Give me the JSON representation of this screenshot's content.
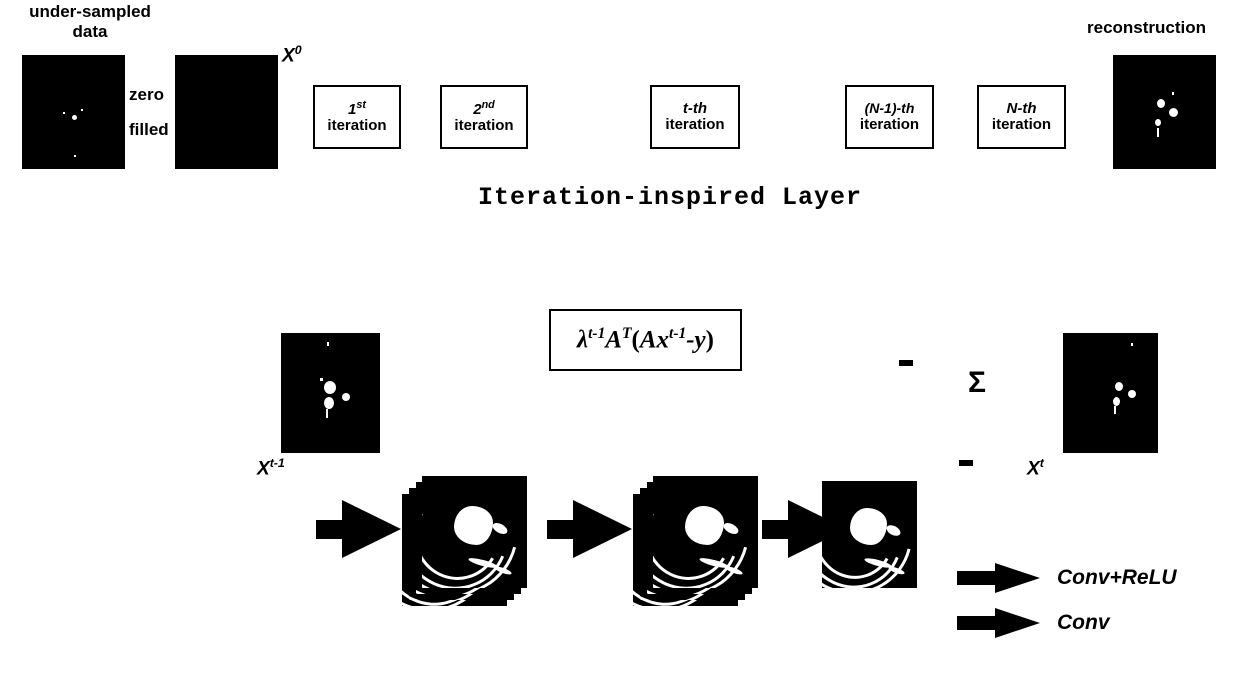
{
  "figure": {
    "title": "Iteration-inspired Layer",
    "top_row": {
      "undersampled_label": "under-sampled\ndata",
      "undersampled_label_line1": "under-sampled",
      "undersampled_label_line2": "data",
      "zero_label": "zero",
      "filled_label": "filled",
      "x0_label": "X",
      "x0_sup": "0",
      "reconstruction_label": "reconstruction",
      "iterations": [
        {
          "top": "1st",
          "top_main": "1",
          "top_sup": "st",
          "bottom": "iteration"
        },
        {
          "top": "2nd",
          "top_main": "2",
          "top_sup": "nd",
          "bottom": "iteration"
        },
        {
          "top": "t-th",
          "bottom": "iteration"
        },
        {
          "top": "(N-1)-th",
          "bottom": "iteration"
        },
        {
          "top": "N-th",
          "bottom": "iteration"
        }
      ]
    },
    "detail_row": {
      "formula_plain": "λ^{t-1} A^T ( A x^{t-1} - y )",
      "formula_lambda": "λ",
      "formula_lambda_sup": "t-1",
      "formula_A": "A",
      "formula_A_sup": "T",
      "formula_open": "(",
      "formula_Ax": "Ax",
      "formula_x_sup": "t-1",
      "formula_minus_y": "-y",
      "formula_close": ")",
      "xprev_label": "X",
      "xprev_sup": "t-1",
      "xnext_label": "X",
      "xnext_sup": "t",
      "sigma_symbol": "Σ",
      "sign_top": "-",
      "sign_bottom": "-"
    },
    "legend": [
      {
        "label": "Conv+ReLU",
        "icon": "arrow-right-icon"
      },
      {
        "label": "Conv",
        "icon": "arrow-right-icon"
      }
    ],
    "colors": {
      "ink": "#000000",
      "paper": "#ffffff"
    }
  }
}
